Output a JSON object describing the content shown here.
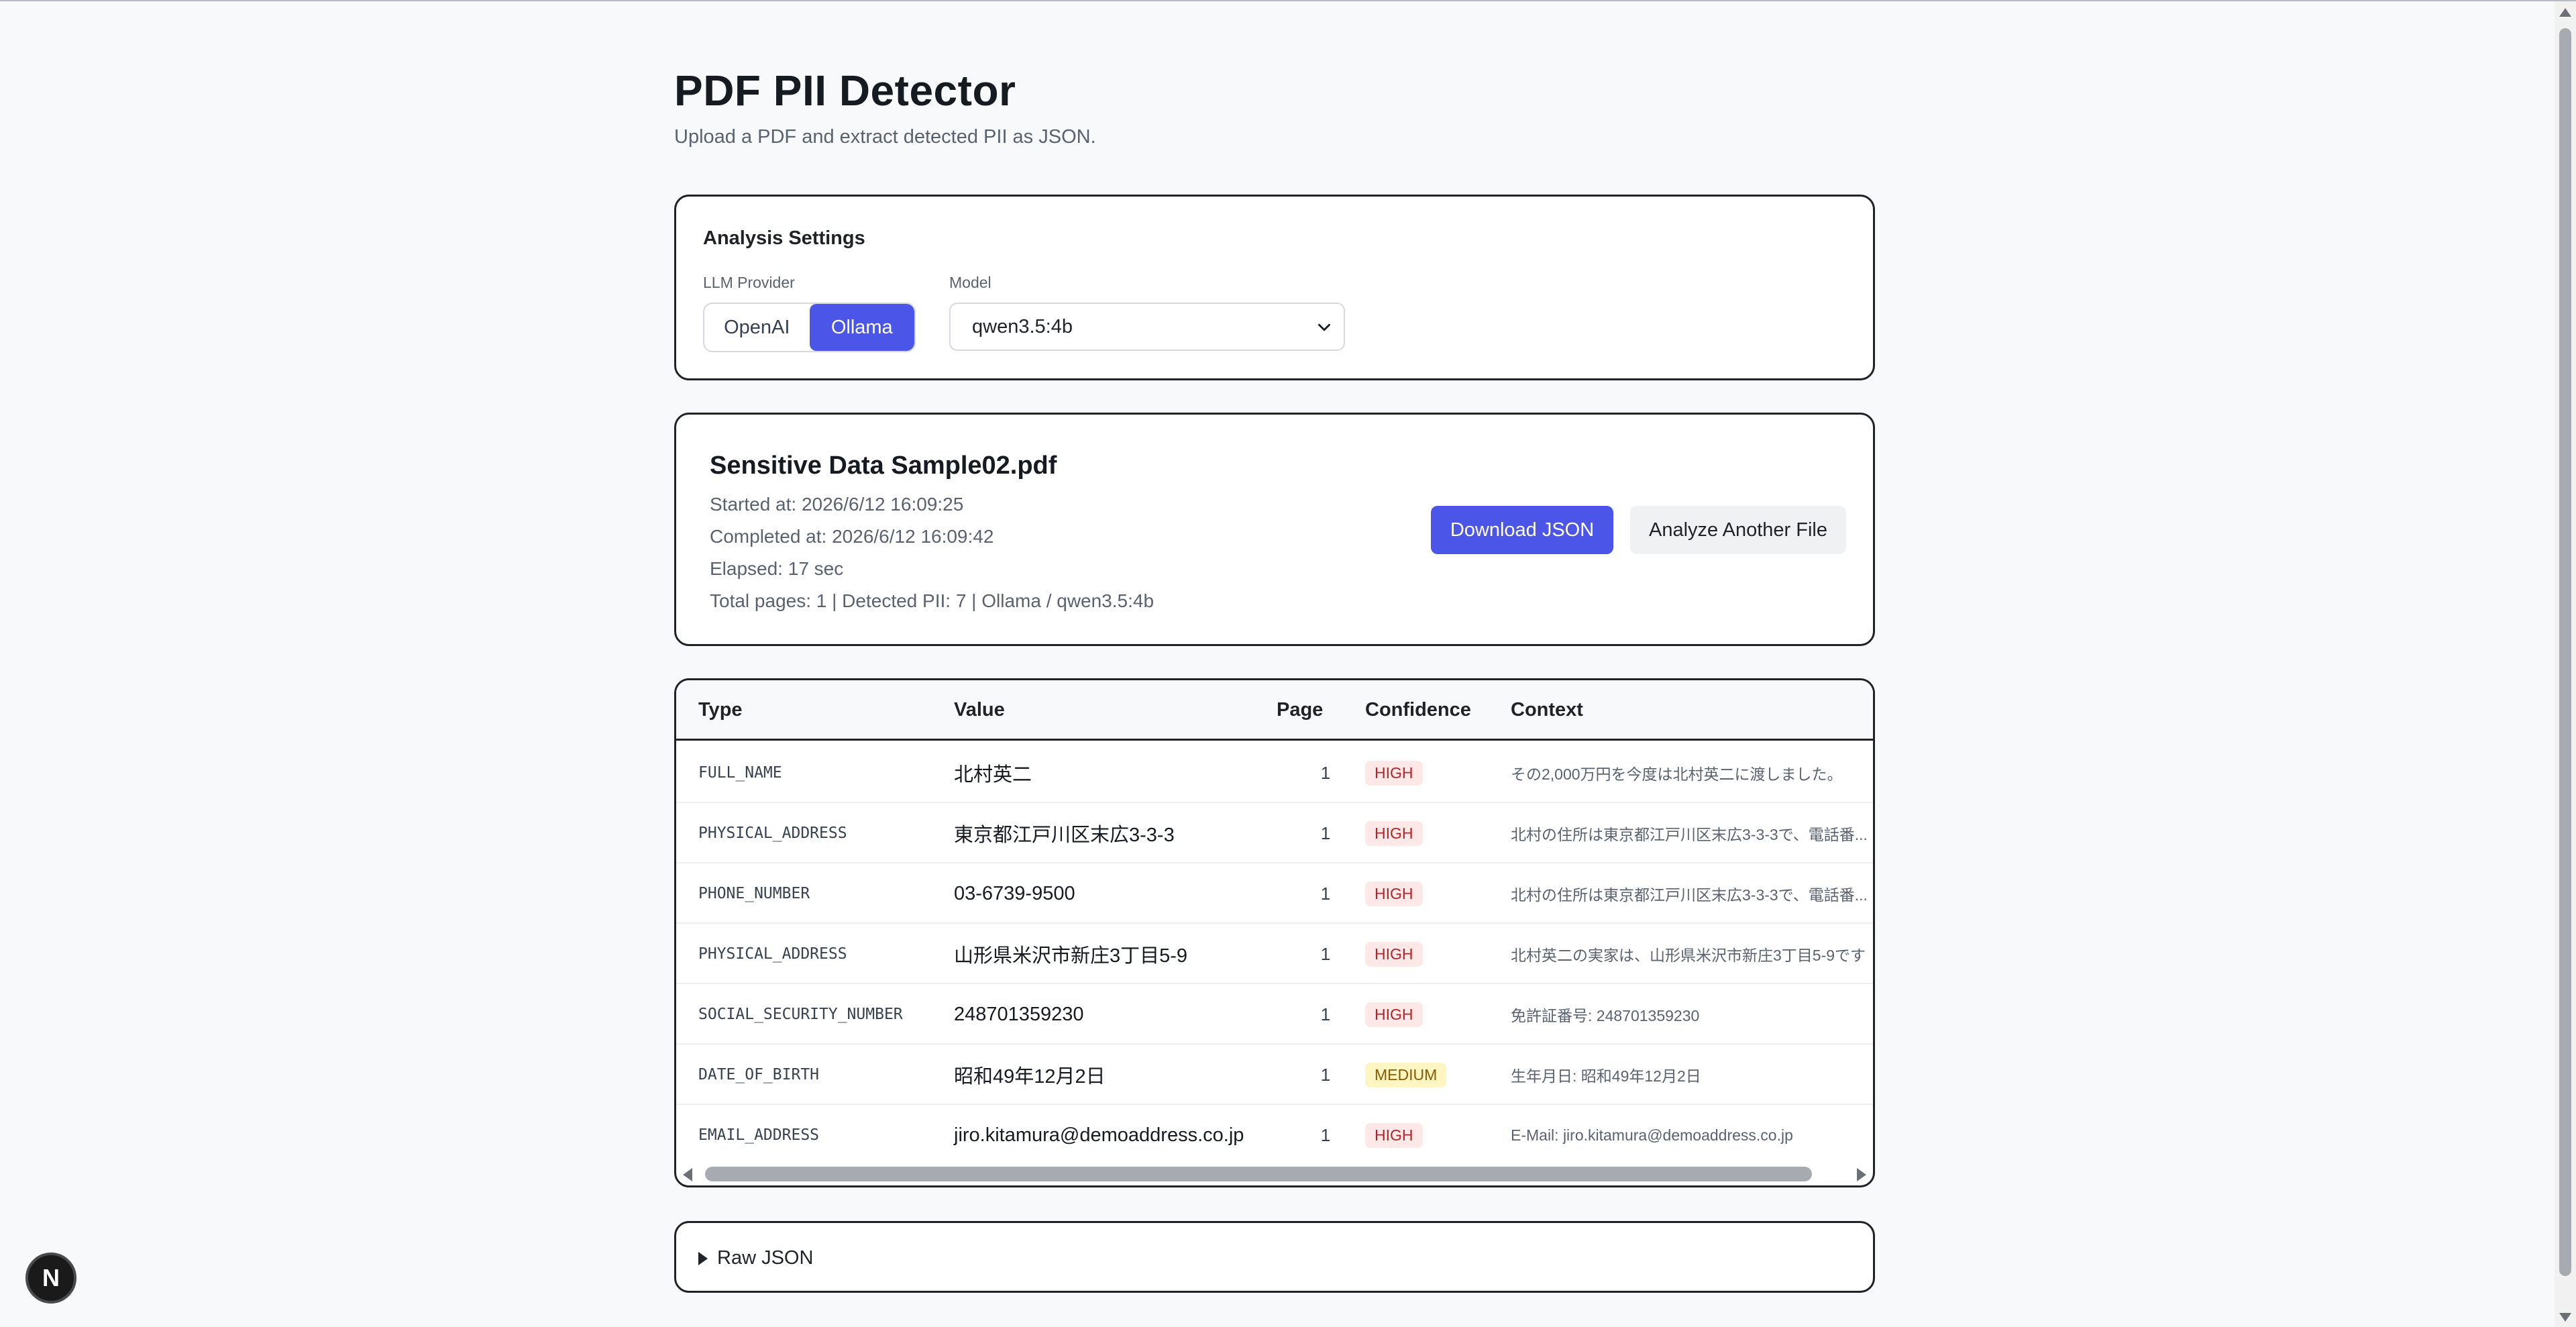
{
  "header": {
    "title": "PDF PII Detector",
    "subtitle": "Upload a PDF and extract detected PII as JSON."
  },
  "settings": {
    "title": "Analysis Settings",
    "provider_label": "LLM Provider",
    "providers": [
      "OpenAI",
      "Ollama"
    ],
    "selected_provider": "Ollama",
    "model_label": "Model",
    "model_value": "qwen3.5:4b"
  },
  "result": {
    "file_name": "Sensitive Data Sample02.pdf",
    "started": "Started at: 2026/6/12 16:09:25",
    "completed": "Completed at: 2026/6/12 16:09:42",
    "elapsed": "Elapsed: 17 sec",
    "summary": "Total pages: 1 | Detected PII: 7 | Ollama / qwen3.5:4b",
    "download_label": "Download JSON",
    "analyze_label": "Analyze Another File"
  },
  "table": {
    "headers": [
      "Type",
      "Value",
      "Page",
      "Confidence",
      "Context"
    ],
    "rows": [
      {
        "type": "FULL_NAME",
        "value": "北村英二",
        "page": "1",
        "confidence": "HIGH",
        "context": "その2,000万円を今度は北村英二に渡しました。"
      },
      {
        "type": "PHYSICAL_ADDRESS",
        "value": "東京都江戸川区末広3-3-3",
        "page": "1",
        "confidence": "HIGH",
        "context": "北村の住所は東京都江戸川区末広3-3-3で、電話番..."
      },
      {
        "type": "PHONE_NUMBER",
        "value": "03-6739-9500",
        "page": "1",
        "confidence": "HIGH",
        "context": "北村の住所は東京都江戸川区末広3-3-3で、電話番..."
      },
      {
        "type": "PHYSICAL_ADDRESS",
        "value": "山形県米沢市新庄3丁目5-9",
        "page": "1",
        "confidence": "HIGH",
        "context": "北村英二の実家は、山形県米沢市新庄3丁目5-9です"
      },
      {
        "type": "SOCIAL_SECURITY_NUMBER",
        "value": "248701359230",
        "page": "1",
        "confidence": "HIGH",
        "context": "免許証番号: 248701359230"
      },
      {
        "type": "DATE_OF_BIRTH",
        "value": "昭和49年12月2日",
        "page": "1",
        "confidence": "MEDIUM",
        "context": "生年月日: 昭和49年12月2日"
      },
      {
        "type": "EMAIL_ADDRESS",
        "value": "jiro.kitamura@demoaddress.co.jp",
        "page": "1",
        "confidence": "HIGH",
        "context": "E-Mail: jiro.kitamura@demoaddress.co.jp"
      }
    ]
  },
  "raw_json": {
    "label": "Raw JSON"
  },
  "dev_badge": {
    "letter": "N"
  },
  "colors": {
    "accent": "#4b55e8",
    "high_badge_bg": "#fde8e8",
    "medium_badge_bg": "#fdf6c3"
  }
}
